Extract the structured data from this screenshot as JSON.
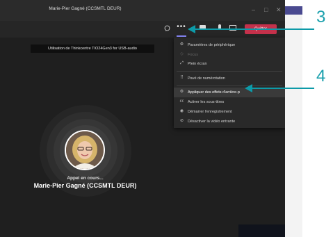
{
  "window": {
    "title": "Marie-Pier Gagné (CCSMTL DEUR)"
  },
  "window_controls": {
    "minimize": "–",
    "maximize": "□",
    "close": "✕"
  },
  "toolbar": {
    "more_label": "•••",
    "leave_label": "Quitter",
    "icons": [
      "chat-icon",
      "more-icon",
      "camera-icon",
      "mic-icon",
      "share-icon"
    ]
  },
  "tooltip": "Utilisation de Thinkcentre TIO24Gen3 for USB-audio",
  "menu": {
    "items": [
      {
        "label": "Paramètres de périphérique",
        "icon": "⚙"
      },
      {
        "label": "Focus",
        "icon": "◇",
        "disabled": true
      },
      {
        "label": "Plein écran",
        "icon": "⤢"
      },
      {
        "label": "Pavé de numérotation",
        "icon": "⠿"
      },
      {
        "label": "Appliquer des effets d'arrière-p",
        "icon": "⚙",
        "highlighted": true
      },
      {
        "label": "Activer les sous-titres",
        "icon": "㏄"
      },
      {
        "label": "Démarrer l'enregistrement",
        "icon": "◉"
      },
      {
        "label": "Désactiver la vidéo entrante",
        "icon": "⊘"
      }
    ]
  },
  "call": {
    "status": "Appel en cours...",
    "name": "Marie-Pier Gagné (CCSMTL DEUR)"
  },
  "callouts": {
    "first": "3",
    "second": "4"
  },
  "colors": {
    "accent": "#1aa0ad",
    "leave": "#c4314b",
    "background": "#1f1f1f"
  }
}
